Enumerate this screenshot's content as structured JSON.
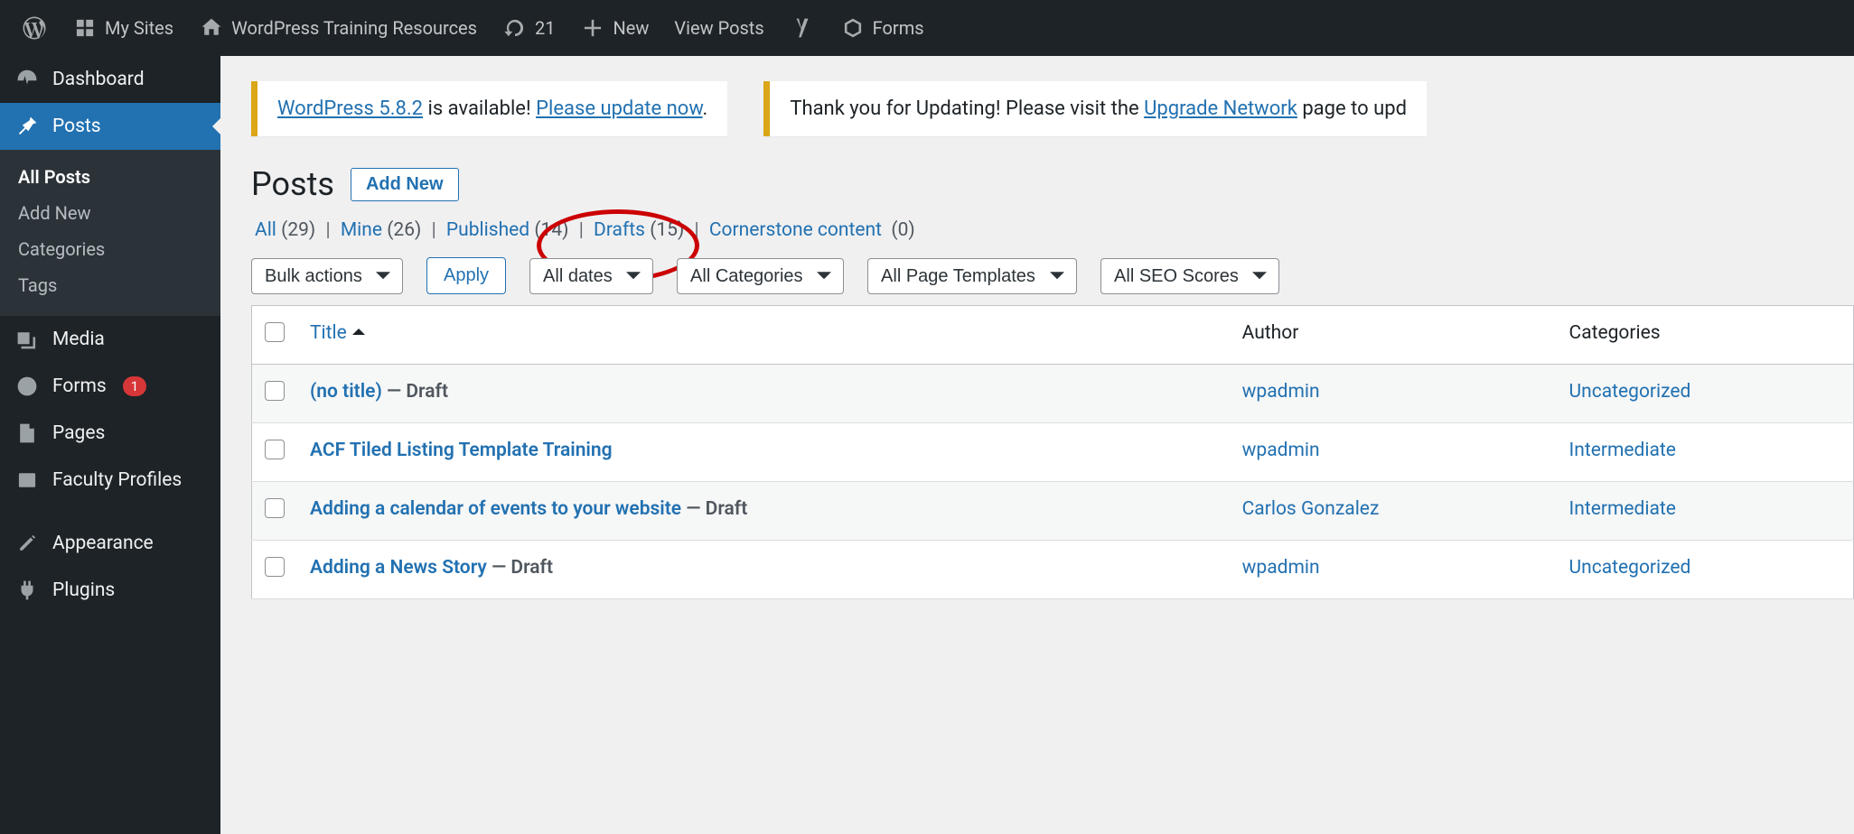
{
  "adminbar": {
    "my_sites": "My Sites",
    "site_name": "WordPress Training Resources",
    "updates_count": "21",
    "new_label": "New",
    "view_posts": "View Posts",
    "forms": "Forms"
  },
  "sidebar": {
    "dashboard": "Dashboard",
    "posts": "Posts",
    "posts_sub": {
      "all": "All Posts",
      "add": "Add New",
      "cats": "Categories",
      "tags": "Tags"
    },
    "media": "Media",
    "forms": "Forms",
    "forms_badge": "1",
    "pages": "Pages",
    "faculty": "Faculty Profiles",
    "appearance": "Appearance",
    "plugins": "Plugins"
  },
  "notices": {
    "update_version_link": "WordPress 5.8.2",
    "update_tail": " is available! ",
    "update_now_link": "Please update now",
    "update_period": ".",
    "thank": "Thank you for Updating! Please visit the ",
    "upgrade_link": "Upgrade Network",
    "thank_tail": " page to upd"
  },
  "heading": {
    "title": "Posts",
    "add_new": "Add New"
  },
  "filters": {
    "all": "All",
    "all_count": "(29)",
    "mine": "Mine",
    "mine_count": "(26)",
    "published": "Published",
    "published_count": "(14)",
    "drafts": "Drafts",
    "drafts_count": "(15)",
    "cornerstone": "Cornerstone content",
    "cornerstone_count": "(0)"
  },
  "actions": {
    "bulk": "Bulk actions",
    "apply": "Apply",
    "dates": "All dates",
    "cats": "All Categories",
    "templates": "All Page Templates",
    "seo": "All SEO Scores"
  },
  "table": {
    "headers": {
      "title": "Title",
      "author": "Author",
      "categories": "Categories"
    },
    "rows": [
      {
        "title": "(no title)",
        "state": "Draft",
        "author": "wpadmin",
        "cat": "Uncategorized"
      },
      {
        "title": "ACF Tiled Listing Template Training",
        "state": "",
        "author": "wpadmin",
        "cat": "Intermediate"
      },
      {
        "title": "Adding a calendar of events to your website",
        "state": "Draft",
        "author": "Carlos Gonzalez",
        "cat": "Intermediate"
      },
      {
        "title": "Adding a News Story",
        "state": "Draft",
        "author": "wpadmin",
        "cat": "Uncategorized"
      }
    ]
  }
}
